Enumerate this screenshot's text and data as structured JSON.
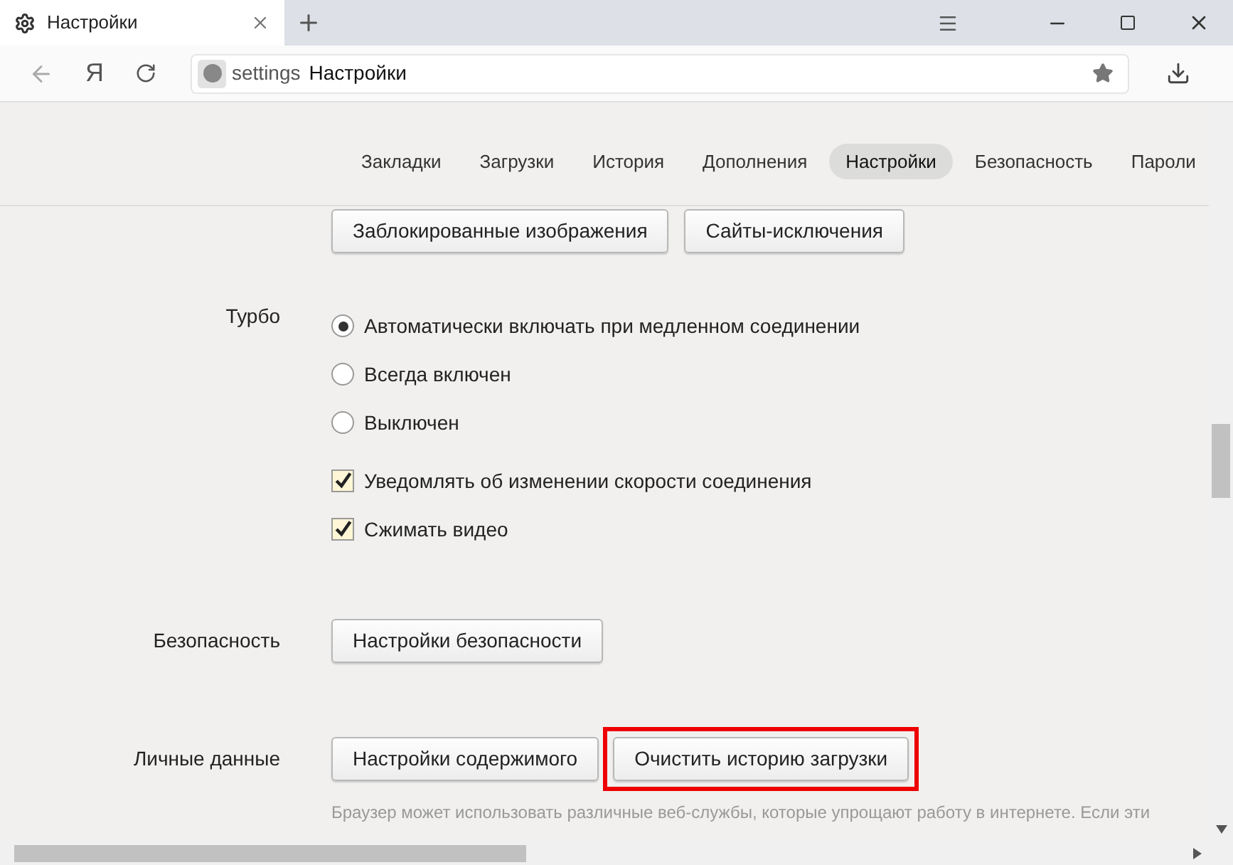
{
  "window": {
    "tab_title": "Настройки"
  },
  "address": {
    "scheme": "settings",
    "title": "Настройки",
    "logo_letter": "Я"
  },
  "nav_tabs": [
    {
      "label": "Закладки",
      "selected": false
    },
    {
      "label": "Загрузки",
      "selected": false
    },
    {
      "label": "История",
      "selected": false
    },
    {
      "label": "Дополнения",
      "selected": false
    },
    {
      "label": "Настройки",
      "selected": true
    },
    {
      "label": "Безопасность",
      "selected": false
    },
    {
      "label": "Пароли",
      "selected": false
    }
  ],
  "cut_buttons": [
    "Заблокированные изображения",
    "Сайты-исключения"
  ],
  "turbo": {
    "label": "Турбо",
    "items": [
      {
        "kind": "radio",
        "label": "Автоматически включать при медленном соединении",
        "selected": true
      },
      {
        "kind": "radio",
        "label": "Всегда включен",
        "selected": false
      },
      {
        "kind": "radio",
        "label": "Выключен",
        "selected": false
      },
      {
        "kind": "checkbox",
        "label": "Уведомлять об изменении скорости соединения",
        "checked": true
      },
      {
        "kind": "checkbox",
        "label": "Сжимать видео",
        "checked": true
      }
    ]
  },
  "security": {
    "label": "Безопасность",
    "buttons": [
      {
        "label": "Настройки безопасности",
        "highlighted": false
      }
    ]
  },
  "personal": {
    "label": "Личные данные",
    "buttons": [
      {
        "label": "Настройки содержимого",
        "highlighted": false
      },
      {
        "label": "Очистить историю загрузки",
        "highlighted": true
      }
    ],
    "description": "Браузер может использовать различные веб-службы, которые упрощают работу в интернете. Если эти"
  }
}
